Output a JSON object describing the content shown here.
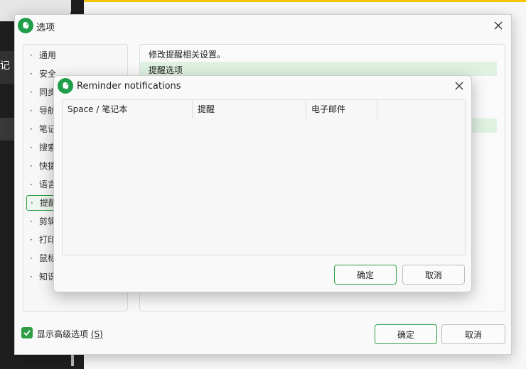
{
  "background": {
    "partial_text": "记"
  },
  "options_dialog": {
    "title": "选项",
    "nav_items": [
      {
        "label": "通用"
      },
      {
        "label": "安全"
      },
      {
        "label": "同步"
      },
      {
        "label": "导航"
      },
      {
        "label": "笔记"
      },
      {
        "label": "搜索"
      },
      {
        "label": "快捷"
      },
      {
        "label": "语言"
      },
      {
        "label": "提醒",
        "active": true
      },
      {
        "label": "剪辑"
      },
      {
        "label": "打印"
      },
      {
        "label": "鼠标"
      },
      {
        "label": "知识"
      }
    ],
    "content": {
      "description": "修改提醒相关设置。",
      "section_title": "提醒选项"
    },
    "show_advanced_label": "显示高级选项",
    "show_advanced_key": "(S)",
    "show_advanced_checked": true,
    "ok_label": "确定",
    "cancel_label": "取消"
  },
  "reminder_dialog": {
    "title": "Reminder notifications",
    "columns": [
      "Space / 笔记本",
      "提醒",
      "电子邮件"
    ],
    "rows": [],
    "ok_label": "确定",
    "cancel_label": "取消"
  },
  "colors": {
    "accent": "#2f9e44",
    "highlight": "#dff2e2",
    "top_bar": "#f5c400"
  },
  "icons": {
    "app_logo": "evernote-elephant-icon",
    "close": "close-icon",
    "check": "checkmark-icon"
  }
}
